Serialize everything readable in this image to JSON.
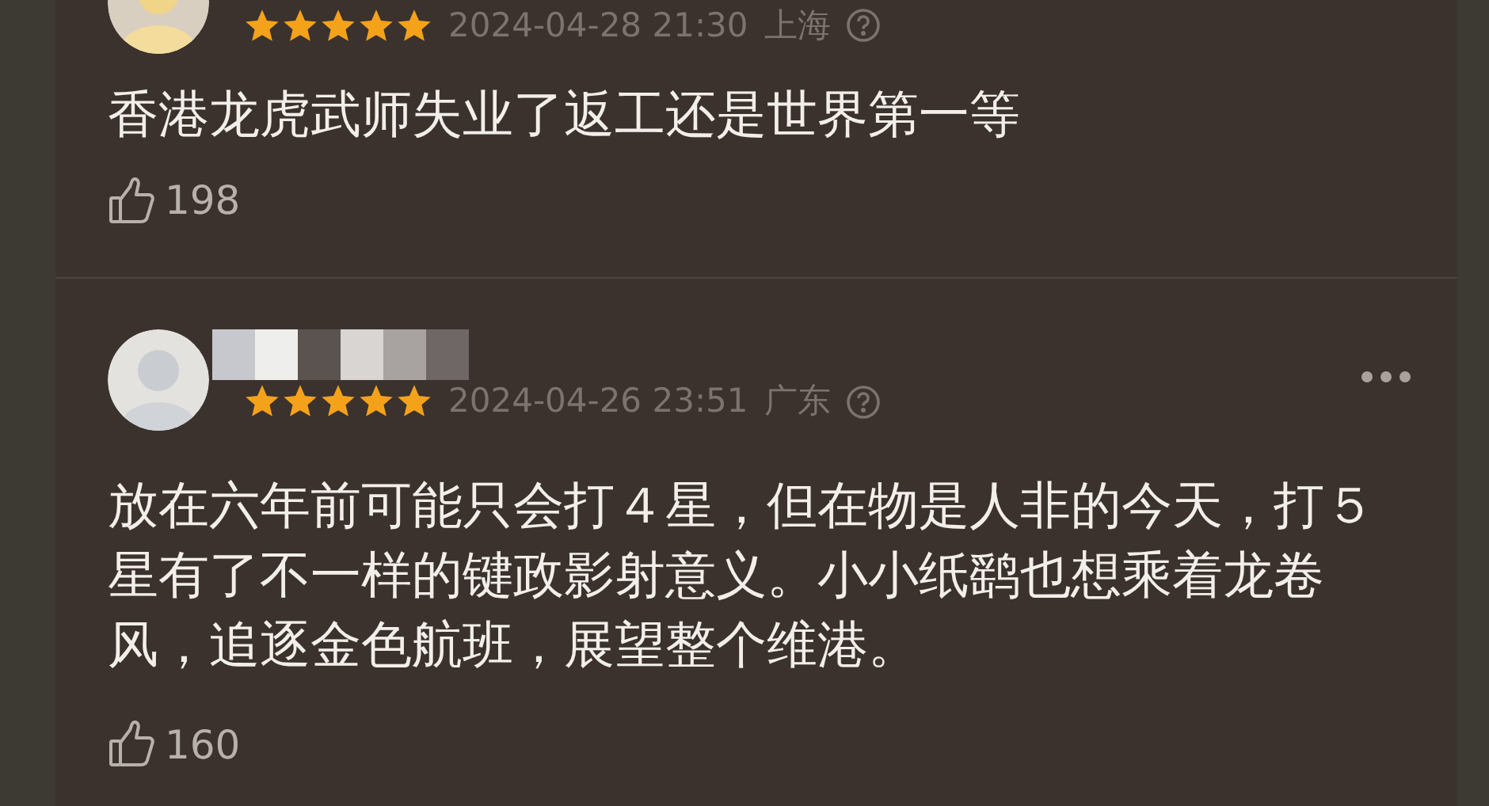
{
  "comments": [
    {
      "stars": 5,
      "date": "2024-04-28 21:30",
      "location": "上海",
      "text": "香港龙虎武师失业了返工还是世界第一等",
      "likes": "198"
    },
    {
      "name_redacted": true,
      "stars": 5,
      "date": "2024-04-26 23:51",
      "location": "广东",
      "text": "放在六年前可能只会打４星，但在物是人非的今天，打５星有了不一样的键政影射意义。小小纸鹞也想乘着龙卷风，追逐金色航班，展望整个维港。",
      "likes": "160",
      "more_menu": true
    }
  ]
}
